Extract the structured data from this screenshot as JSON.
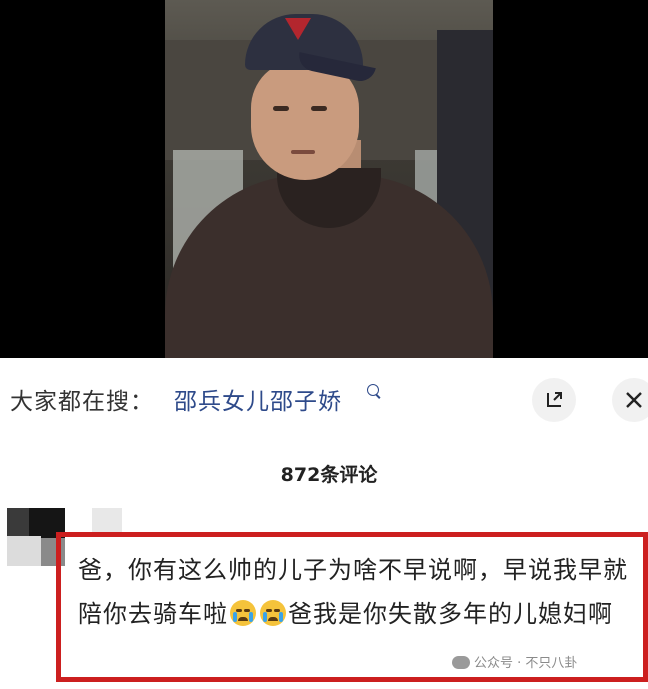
{
  "search": {
    "prefix": "大家都在搜：",
    "term": "邵兵女儿邵子娇",
    "icon": "search-icon"
  },
  "controls": {
    "expand_icon": "expand-icon",
    "close_icon": "close-icon"
  },
  "comments": {
    "count_label": "872条评论",
    "items": [
      {
        "text_part1": "爸，你有这么帅的儿子为啥不早说啊，早说我早就陪你去骑车啦",
        "emojis": [
          "crying-emoji",
          "crying-emoji"
        ],
        "text_part2": "爸我是你失散多年的儿媳妇啊"
      }
    ]
  },
  "watermark": {
    "text": "公众号 · 不只八卦"
  },
  "colors": {
    "search_term": "#2e4a8a",
    "highlight_border": "#cc1f1f"
  }
}
